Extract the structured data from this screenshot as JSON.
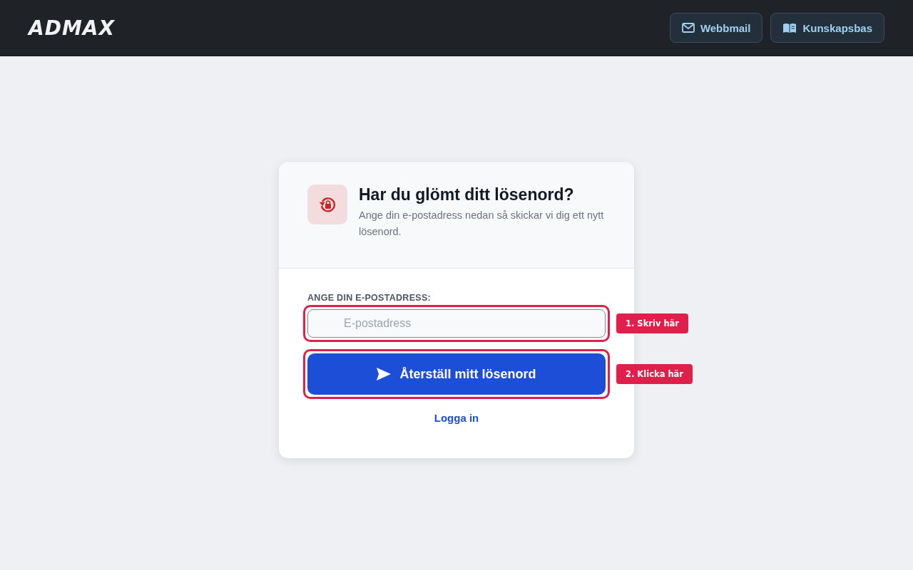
{
  "header": {
    "logo": "ADMAX",
    "buttons": [
      {
        "kind": "mail",
        "label": "Webbmail"
      },
      {
        "kind": "book",
        "label": "Kunskapsbas"
      }
    ]
  },
  "card": {
    "title": "Har du glömt ditt lösenord?",
    "subtitle": "Ange din e-postadress nedan så skickar vi dig ett nytt lösenord.",
    "field_label": "ANGE DIN E-POSTADRESS:",
    "email": {
      "placeholder": "E-postadress"
    },
    "submit": "Återställ mitt lösenord",
    "link": "Logga in"
  },
  "annotations": [
    "1. Skriv här",
    "2. Klicka här"
  ]
}
